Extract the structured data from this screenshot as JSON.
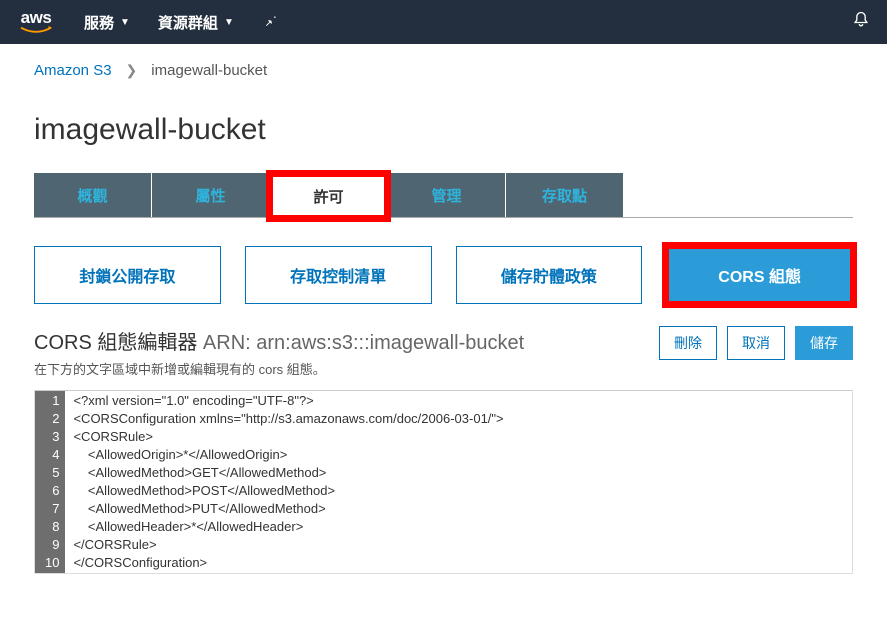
{
  "nav": {
    "services": "服務",
    "resource_groups": "資源群組"
  },
  "breadcrumb": {
    "root": "Amazon S3",
    "current": "imagewall-bucket"
  },
  "page_title": "imagewall-bucket",
  "tabs": {
    "overview": "概觀",
    "properties": "屬性",
    "permissions": "許可",
    "management": "管理",
    "access_points": "存取點"
  },
  "sub_tabs": {
    "block_public": "封鎖公開存取",
    "acl": "存取控制清單",
    "bucket_policy": "儲存貯體政策",
    "cors": "CORS 組態"
  },
  "editor": {
    "title": "CORS 組態編輯器",
    "arn_label": "ARN:",
    "arn": "arn:aws:s3:::imagewall-bucket",
    "subtitle": "在下方的文字區域中新增或編輯現有的 cors 組態。"
  },
  "actions": {
    "delete": "刪除",
    "cancel": "取消",
    "save": "儲存"
  },
  "code_lines": [
    "<?xml version=\"1.0\" encoding=\"UTF-8\"?>",
    "<CORSConfiguration xmlns=\"http://s3.amazonaws.com/doc/2006-03-01/\">",
    "<CORSRule>",
    "    <AllowedOrigin>*</AllowedOrigin>",
    "    <AllowedMethod>GET</AllowedMethod>",
    "    <AllowedMethod>POST</AllowedMethod>",
    "    <AllowedMethod>PUT</AllowedMethod>",
    "    <AllowedHeader>*</AllowedHeader>",
    "</CORSRule>",
    "</CORSConfiguration>"
  ]
}
